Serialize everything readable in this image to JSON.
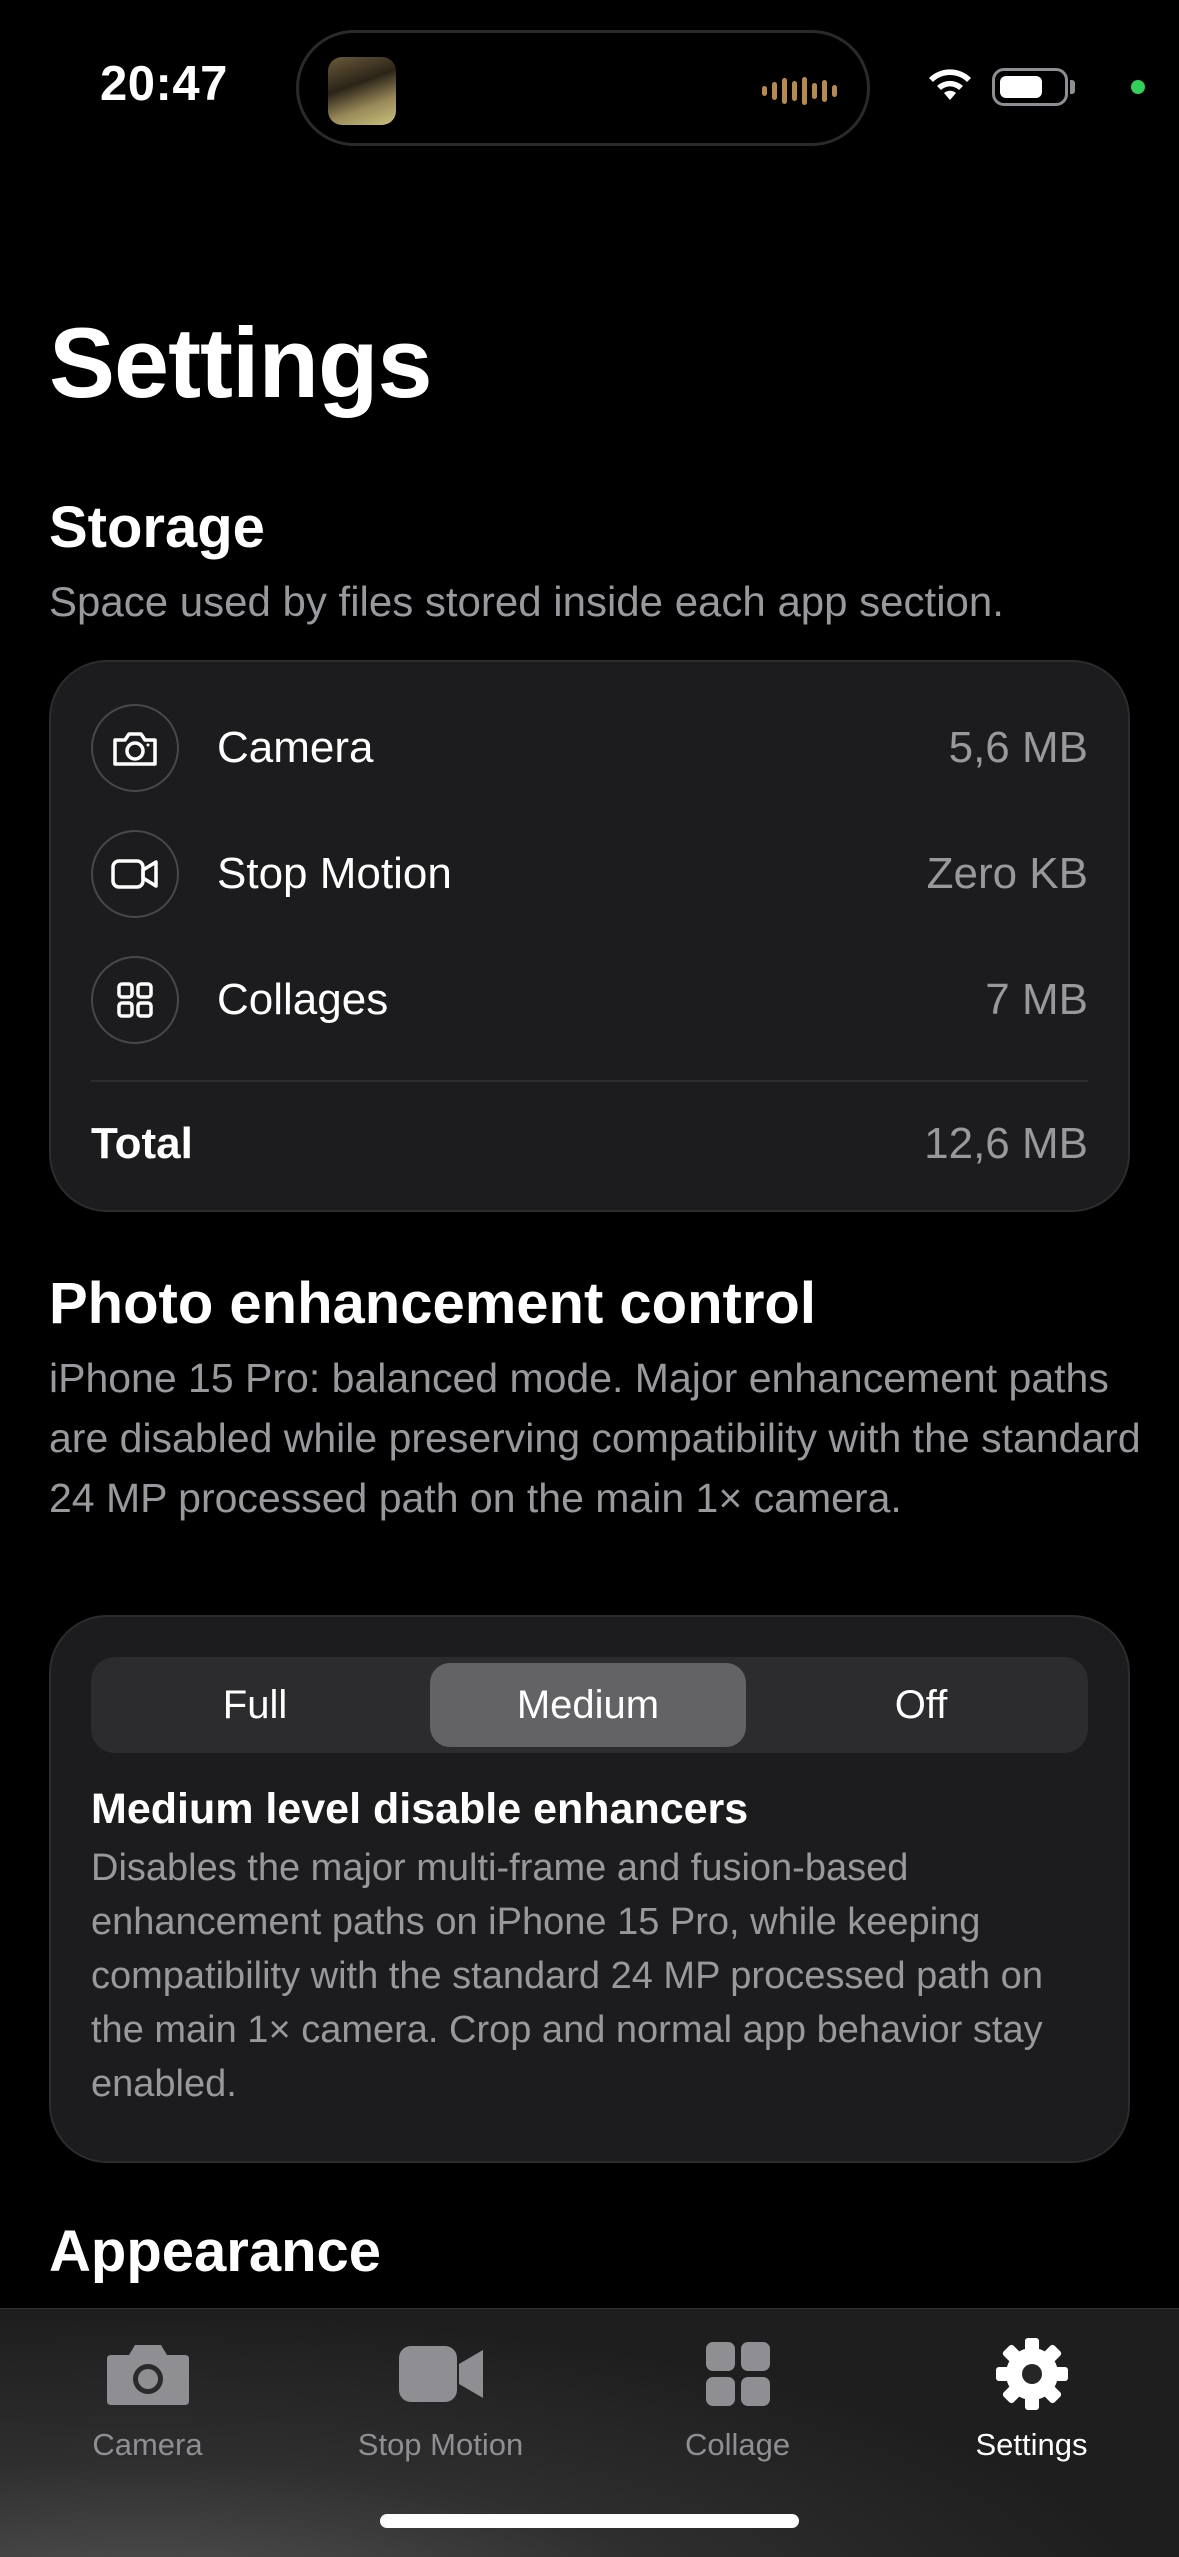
{
  "status_bar": {
    "time": "20:47"
  },
  "page_title": "Settings",
  "storage": {
    "title": "Storage",
    "description": "Space used by files stored inside each app section.",
    "items": [
      {
        "icon": "camera-icon",
        "label": "Camera",
        "value": "5,6 MB"
      },
      {
        "icon": "video-icon",
        "label": "Stop Motion",
        "value": "Zero KB"
      },
      {
        "icon": "grid-icon",
        "label": "Collages",
        "value": "7 MB"
      }
    ],
    "total_label": "Total",
    "total_value": "12,6 MB"
  },
  "enhancement": {
    "title": "Photo enhancement control",
    "description": "iPhone 15 Pro: balanced mode. Major enhancement paths are disabled while preserving compatibility with the standard 24 MP processed path on the main 1× camera.",
    "options": [
      "Full",
      "Medium",
      "Off"
    ],
    "selected": "Medium",
    "mode_title": "Medium level disable enhancers",
    "mode_description": "Disables the major multi-frame and fusion-based enhancement paths on iPhone 15 Pro, while keeping compatibility with the standard 24 MP processed path on the main 1× camera. Crop and normal app behavior stay enabled."
  },
  "appearance": {
    "title": "Appearance"
  },
  "tab_bar": {
    "tabs": [
      {
        "label": "Camera",
        "icon": "camera-fill-icon",
        "active": false
      },
      {
        "label": "Stop Motion",
        "icon": "video-fill-icon",
        "active": false
      },
      {
        "label": "Collage",
        "icon": "grid-fill-icon",
        "active": false
      },
      {
        "label": "Settings",
        "icon": "gear-icon",
        "active": true
      }
    ]
  },
  "colors": {
    "background": "#000000",
    "card": "#1c1c1e",
    "secondary_text": "#98989d",
    "active_segment": "#636366",
    "mic_indicator": "#30d158"
  }
}
